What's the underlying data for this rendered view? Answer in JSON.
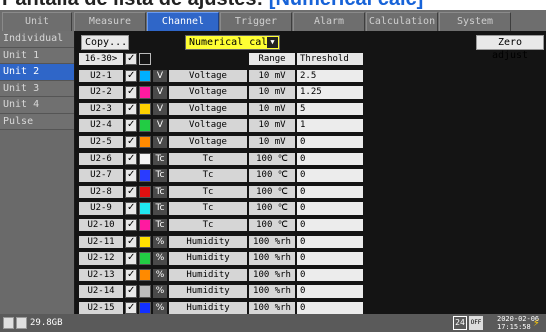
{
  "banner": {
    "prefix": "Pantalla de lista de ajustes:",
    "highlight": "[Numerical calc]"
  },
  "tabs": [
    {
      "label": "Unit",
      "active": false
    },
    {
      "label": "Measure",
      "active": false
    },
    {
      "label": "Channel",
      "active": true
    },
    {
      "label": "Trigger",
      "active": false
    },
    {
      "label": "Alarm",
      "active": false
    },
    {
      "label": "Calculation",
      "active": false
    },
    {
      "label": "System",
      "active": false
    }
  ],
  "sidebar": [
    {
      "label": "Individual",
      "active": false
    },
    {
      "label": "Unit 1",
      "active": false
    },
    {
      "label": "Unit 2",
      "active": true
    },
    {
      "label": "Unit 3",
      "active": false
    },
    {
      "label": "Unit 4",
      "active": false
    },
    {
      "label": "Pulse",
      "active": false
    }
  ],
  "toolbar": {
    "copy_label": "Copy...",
    "mode_label": "Numerical calc",
    "zero_label": "Zero adjust"
  },
  "table": {
    "header": {
      "channel": "16-30>",
      "range": "Range",
      "threshold": "Threshold"
    },
    "rows": [
      {
        "ch": "U2-1",
        "color": "#00b0ff",
        "type": "V",
        "item": "Voltage",
        "range": "10 mV",
        "threshold": "2.5"
      },
      {
        "ch": "U2-2",
        "color": "#ff1aa0",
        "type": "V",
        "item": "Voltage",
        "range": "10 mV",
        "threshold": "1.25"
      },
      {
        "ch": "U2-3",
        "color": "#ffd000",
        "type": "V",
        "item": "Voltage",
        "range": "10 mV",
        "threshold": "5"
      },
      {
        "ch": "U2-4",
        "color": "#22cc44",
        "type": "V",
        "item": "Voltage",
        "range": "10 mV",
        "threshold": "1"
      },
      {
        "ch": "U2-5",
        "color": "#ff8a00",
        "type": "V",
        "item": "Voltage",
        "range": "10 mV",
        "threshold": "0"
      },
      {
        "ch": "U2-6",
        "color": "#f4f4f4",
        "type": "Tc",
        "item": "Tc",
        "range": "100 ℃",
        "threshold": "0"
      },
      {
        "ch": "U2-7",
        "color": "#2a3cff",
        "type": "Tc",
        "item": "Tc",
        "range": "100 ℃",
        "threshold": "0"
      },
      {
        "ch": "U2-8",
        "color": "#e01010",
        "type": "Tc",
        "item": "Tc",
        "range": "100 ℃",
        "threshold": "0"
      },
      {
        "ch": "U2-9",
        "color": "#20e8f0",
        "type": "Tc",
        "item": "Tc",
        "range": "100 ℃",
        "threshold": "0"
      },
      {
        "ch": "U2-10",
        "color": "#ff1aa0",
        "type": "Tc",
        "item": "Tc",
        "range": "100 ℃",
        "threshold": "0"
      },
      {
        "ch": "U2-11",
        "color": "#ffe000",
        "type": "%",
        "item": "Humidity",
        "range": "100 %rh",
        "threshold": "0"
      },
      {
        "ch": "U2-12",
        "color": "#22cc44",
        "type": "%",
        "item": "Humidity",
        "range": "100 %rh",
        "threshold": "0"
      },
      {
        "ch": "U2-13",
        "color": "#ff8a00",
        "type": "%",
        "item": "Humidity",
        "range": "100 %rh",
        "threshold": "0"
      },
      {
        "ch": "U2-14",
        "color": "#bdbdbd",
        "type": "%",
        "item": "Humidity",
        "range": "100 %rh",
        "threshold": "0"
      },
      {
        "ch": "U2-15",
        "color": "#1230ff",
        "type": "%",
        "item": "Humidity",
        "range": "100 %rh",
        "threshold": "0"
      }
    ]
  },
  "status": {
    "memory": "29.8GB",
    "channel_num": "24",
    "off_label": "OFF",
    "date": "2020-02-06",
    "time": "17:15:58"
  }
}
